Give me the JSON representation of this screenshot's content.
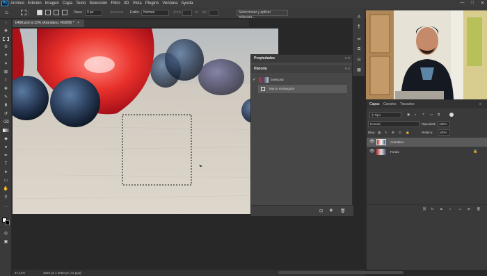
{
  "menubar": {
    "items": [
      "Archivo",
      "Edición",
      "Imagen",
      "Capa",
      "Texto",
      "Selección",
      "Filtro",
      "3D",
      "Vista",
      "Plugins",
      "Ventana",
      "Ayuda"
    ],
    "min": "—",
    "max": "□",
    "close": "✕"
  },
  "options": {
    "desv_label": "Desv.:",
    "desv_value": "0 px",
    "suavizar": "Suavizar",
    "estilo_label": "Estilo:",
    "estilo_value": "Normal",
    "anch": "Anch.:",
    "alt": "Alt.:",
    "select_mask": "Seleccionar y aplicar máscara..."
  },
  "document": {
    "tab_title": "b468.psd al 22% (Arandano, RGB/8) *",
    "close": "×"
  },
  "status": {
    "zoom": "47,14%",
    "doc_info": "3020 px x 2000 px (72 ppp)"
  },
  "propiedades": {
    "title": "Propiedades"
  },
  "historia": {
    "title": "Historia",
    "snapshot": "b468.psd",
    "step": "Marco rectangular"
  },
  "layers": {
    "tabs": [
      "Capas",
      "Canales",
      "Trazados"
    ],
    "filter": "Tipo",
    "blend": "Normal",
    "opacity_label": "Opacidad:",
    "opacity_value": "100%",
    "lock_label": "Bloq.:",
    "fill_label": "Relleno:",
    "fill_value": "100%",
    "rows": [
      {
        "name": "Arandano",
        "selected": true
      },
      {
        "name": "Fondo",
        "selected": false
      }
    ]
  },
  "colors": {
    "accent": "#31a8ff",
    "panel": "#3a3a3a",
    "selected": "#5a5a5a"
  }
}
